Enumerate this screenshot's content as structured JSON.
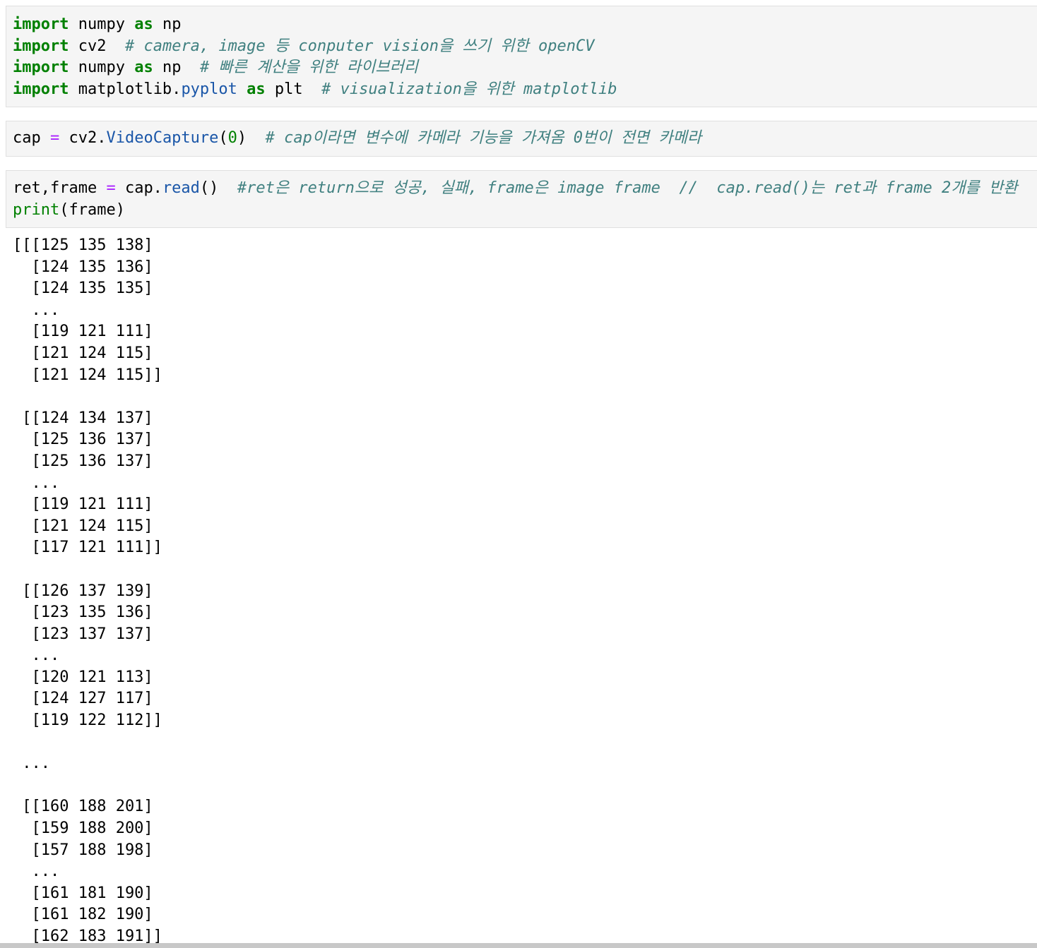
{
  "cells": [
    {
      "lines": [
        [
          {
            "t": "import",
            "c": "kw"
          },
          {
            "t": " numpy ",
            "c": ""
          },
          {
            "t": "as",
            "c": "kw"
          },
          {
            "t": " np",
            "c": ""
          }
        ],
        [
          {
            "t": "import",
            "c": "kw"
          },
          {
            "t": " cv2  ",
            "c": ""
          },
          {
            "t": "# camera, image 등 conputer vision을 쓰기 위한 openCV",
            "c": "cm"
          }
        ],
        [
          {
            "t": "import",
            "c": "kw"
          },
          {
            "t": " numpy ",
            "c": ""
          },
          {
            "t": "as",
            "c": "kw"
          },
          {
            "t": " np  ",
            "c": ""
          },
          {
            "t": "# 빠른 계산을 위한 라이브러리",
            "c": "cm"
          }
        ],
        [
          {
            "t": "import",
            "c": "kw"
          },
          {
            "t": " matplotlib.",
            "c": ""
          },
          {
            "t": "pyplot",
            "c": "at"
          },
          {
            "t": " ",
            "c": ""
          },
          {
            "t": "as",
            "c": "kw"
          },
          {
            "t": " plt  ",
            "c": ""
          },
          {
            "t": "# visualization을 위한 matplotlib",
            "c": "cm"
          }
        ]
      ]
    },
    {
      "lines": [
        [
          {
            "t": "cap ",
            "c": ""
          },
          {
            "t": "=",
            "c": "op"
          },
          {
            "t": " cv2.",
            "c": ""
          },
          {
            "t": "VideoCapture",
            "c": "at"
          },
          {
            "t": "(",
            "c": ""
          },
          {
            "t": "0",
            "c": "nm"
          },
          {
            "t": ")  ",
            "c": ""
          },
          {
            "t": "# cap이라면 변수에 카메라 기능을 가져옴 0번이 전면 카메라",
            "c": "cm"
          }
        ]
      ]
    },
    {
      "lines": [
        [
          {
            "t": "ret,frame ",
            "c": ""
          },
          {
            "t": "=",
            "c": "op"
          },
          {
            "t": " cap.",
            "c": ""
          },
          {
            "t": "read",
            "c": "at"
          },
          {
            "t": "()  ",
            "c": ""
          },
          {
            "t": "#ret은 return으로 성공, 실패, frame은 image frame  //  cap.read()는 ret과 frame 2개를 반환",
            "c": "cm"
          }
        ],
        [
          {
            "t": "print",
            "c": "bi"
          },
          {
            "t": "(frame)",
            "c": ""
          }
        ]
      ]
    }
  ],
  "output_lines": [
    "[[[125 135 138]",
    "  [124 135 136]",
    "  [124 135 135]",
    "  ...",
    "  [119 121 111]",
    "  [121 124 115]",
    "  [121 124 115]]",
    "",
    " [[124 134 137]",
    "  [125 136 137]",
    "  [125 136 137]",
    "  ...",
    "  [119 121 111]",
    "  [121 124 115]",
    "  [117 121 111]]",
    "",
    " [[126 137 139]",
    "  [123 135 136]",
    "  [123 137 137]",
    "  ...",
    "  [120 121 113]",
    "  [124 127 117]",
    "  [119 122 112]]",
    "",
    " ...",
    "",
    " [[160 188 201]",
    "  [159 188 200]",
    "  [157 188 198]",
    "  ...",
    "  [161 181 190]",
    "  [161 182 190]",
    "  [162 183 191]]"
  ]
}
